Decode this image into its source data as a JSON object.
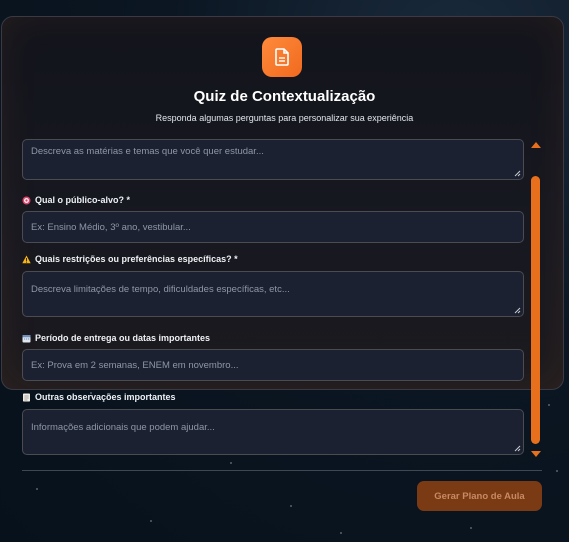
{
  "header": {
    "title": "Quiz de Contextualização",
    "subtitle": "Responda algumas perguntas para personalizar sua experiência",
    "icon": "document-icon",
    "accent": "#f47a2a"
  },
  "fields": [
    {
      "label": "",
      "placeholder": "Descreva as matérias e temas que você quer estudar...",
      "type": "textarea",
      "icon": ""
    },
    {
      "label": "Qual o público-alvo? *",
      "placeholder": "Ex: Ensino Médio, 3º ano, vestibular...",
      "type": "input",
      "icon": "target-icon"
    },
    {
      "label": "Quais restrições ou preferências específicas? *",
      "placeholder": "Descreva limitações de tempo, dificuldades específicas, etc...",
      "type": "textarea",
      "icon": "warning-icon"
    },
    {
      "label": "Período de entrega ou datas importantes",
      "placeholder": "Ex: Prova em 2 semanas, ENEM em novembro...",
      "type": "input",
      "icon": "calendar-icon"
    },
    {
      "label": "Outras observações importantes",
      "placeholder": "Informações adicionais que podem ajudar...",
      "type": "textarea",
      "icon": "memo-icon"
    }
  ],
  "submit_label": "Gerar Plano de Aula",
  "colors": {
    "accent": "#e8701c",
    "submit_bg": "#7a3a14",
    "submit_text": "#c78a63",
    "field_bg": "#1b2130"
  }
}
